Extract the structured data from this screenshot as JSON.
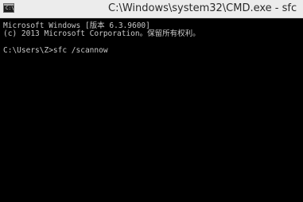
{
  "window": {
    "title": "C:\\Windows\\system32\\CMD.exe - sfc",
    "icon": "cmd-icon",
    "icon_prompt": "C:\\",
    "background": "#000000",
    "text_color": "#c8c8c8"
  },
  "console": {
    "lines": [
      "Microsoft Windows [版本 6.3.9600]",
      "(c) 2013 Microsoft Corporation。保留所有权利。",
      "",
      "C:\\Users\\Z>sfc /scannow"
    ]
  }
}
